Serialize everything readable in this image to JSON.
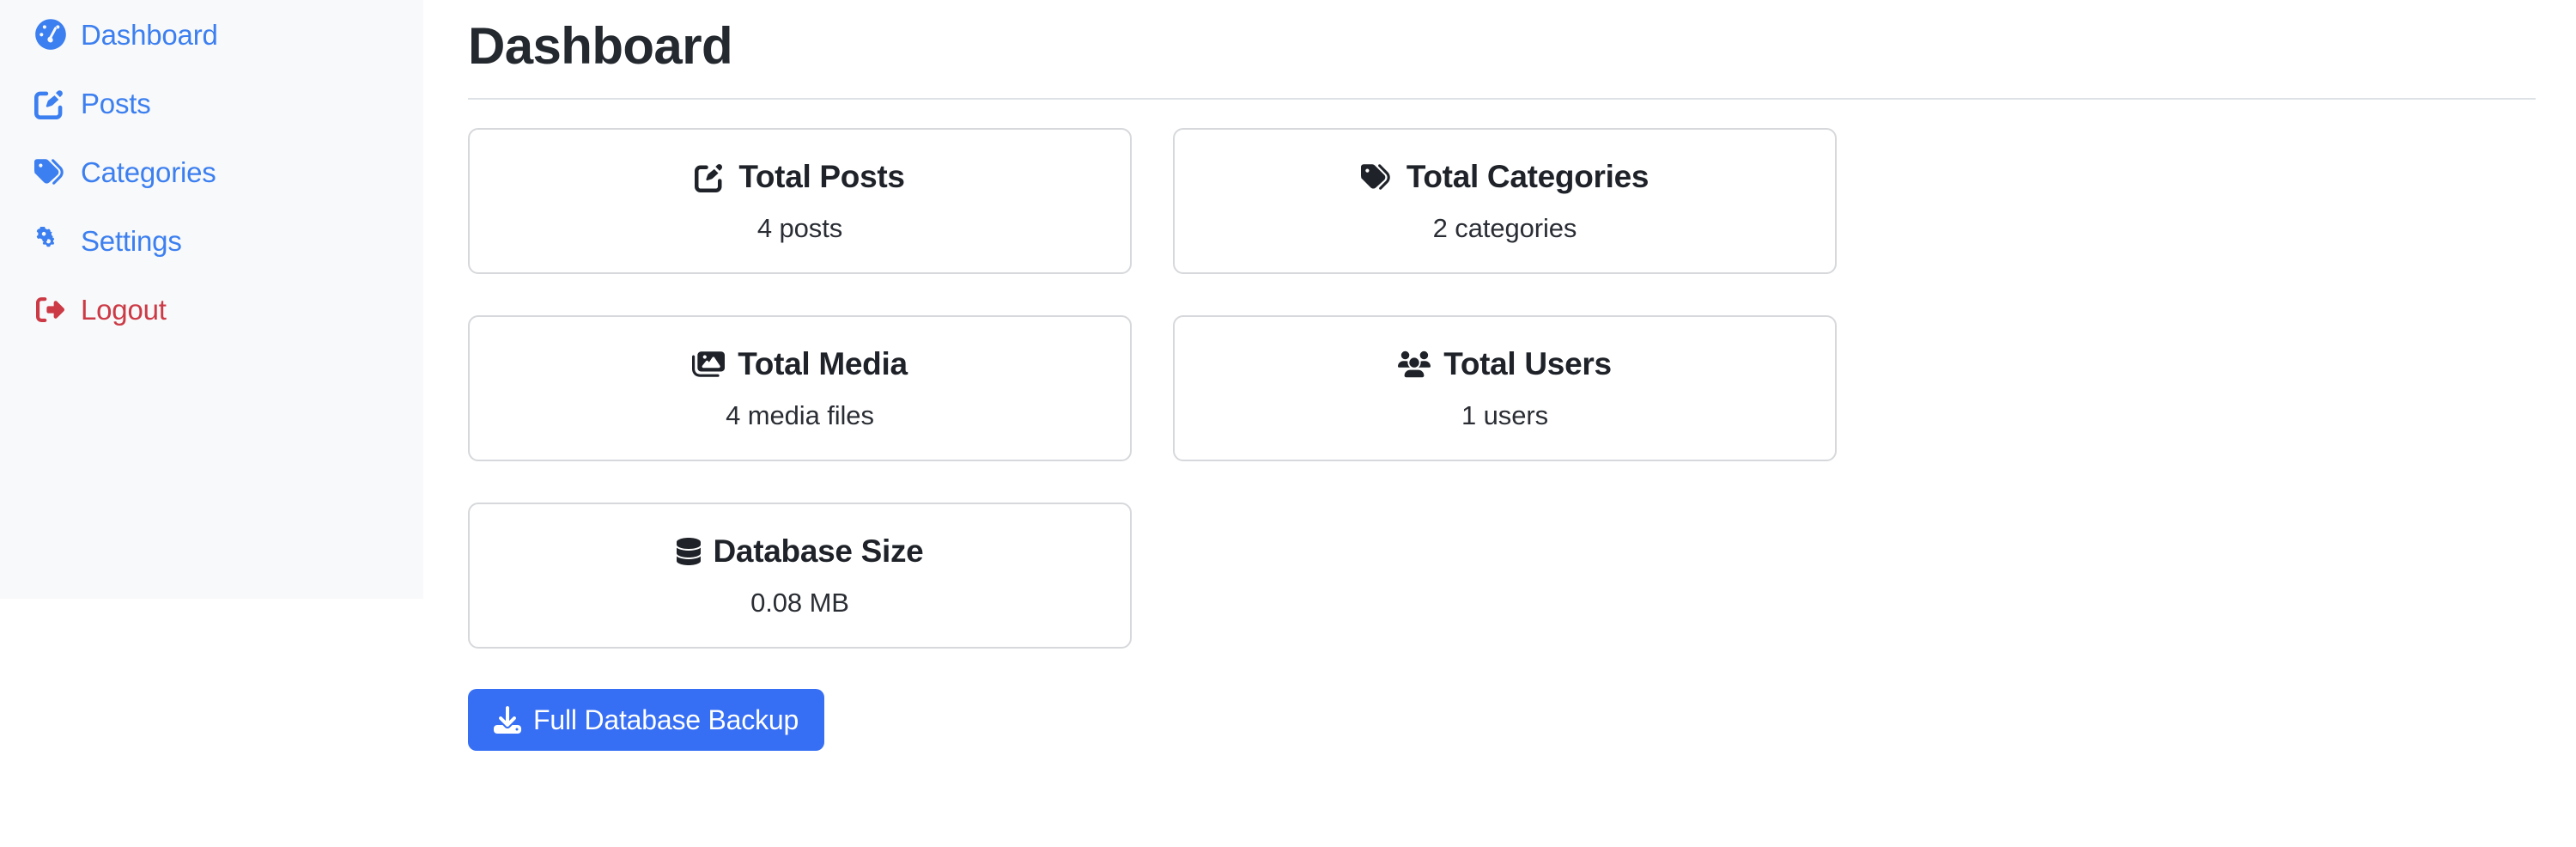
{
  "theme": {
    "sidebar_bg": "#f8f9fa",
    "link_color": "#3c7ff0",
    "danger_color": "#cc3a46",
    "accent_button": "#366ef4",
    "card_border": "#d6d8db",
    "text_color": "#212529"
  },
  "sidebar": {
    "items": [
      {
        "label": "Dashboard",
        "icon": "gauge-icon",
        "style": "primary"
      },
      {
        "label": "Posts",
        "icon": "pen-to-square-icon",
        "style": "primary"
      },
      {
        "label": "Categories",
        "icon": "tags-icon",
        "style": "primary"
      },
      {
        "label": "Settings",
        "icon": "gears-icon",
        "style": "primary"
      },
      {
        "label": "Logout",
        "icon": "sign-out-icon",
        "style": "danger"
      }
    ]
  },
  "main": {
    "page_title": "Dashboard",
    "cards": [
      {
        "title": "Total Posts",
        "value": "4 posts",
        "icon": "pen-to-square-icon"
      },
      {
        "title": "Total Categories",
        "value": "2 categories",
        "icon": "tags-icon"
      },
      {
        "title": "Total Media",
        "value": "4 media files",
        "icon": "images-icon"
      },
      {
        "title": "Total Users",
        "value": "1 users",
        "icon": "users-icon"
      },
      {
        "title": "Database Size",
        "value": "0.08 MB",
        "icon": "database-icon"
      }
    ],
    "backup_button": {
      "label": "Full Database Backup",
      "icon": "download-icon"
    }
  }
}
